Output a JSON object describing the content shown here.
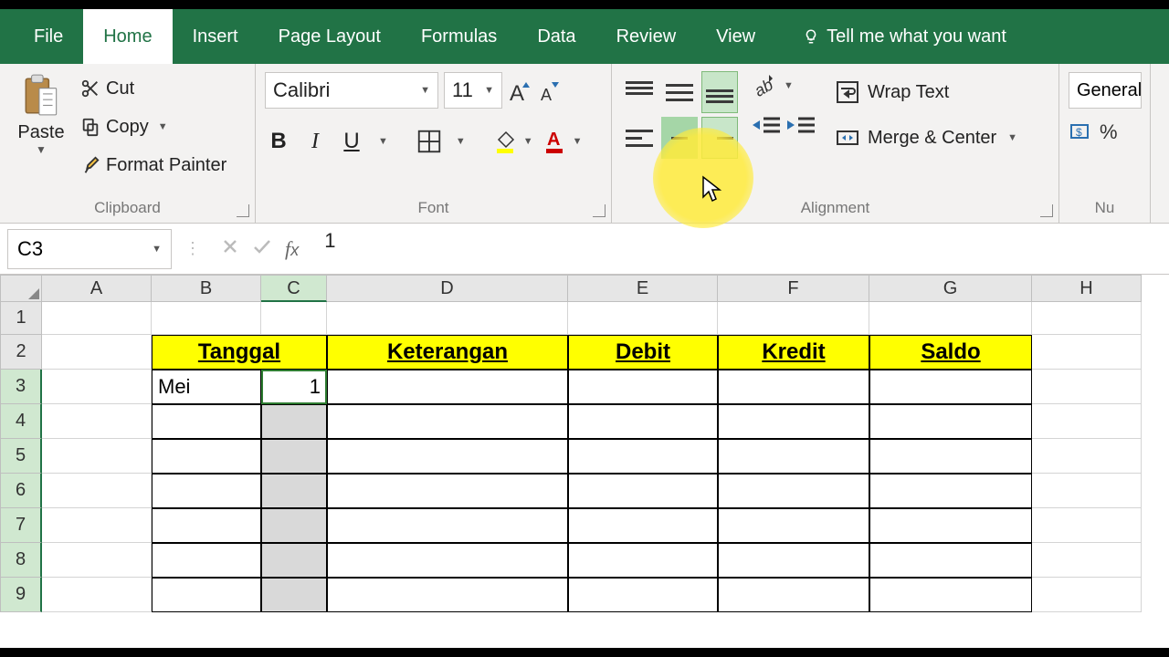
{
  "ribbonTabs": {
    "file": "File",
    "home": "Home",
    "insert": "Insert",
    "pageLayout": "Page Layout",
    "formulas": "Formulas",
    "data": "Data",
    "review": "Review",
    "view": "View",
    "tellMe": "Tell me what you want"
  },
  "clipboard": {
    "paste": "Paste",
    "cut": "Cut",
    "copy": "Copy",
    "formatPainter": "Format Painter",
    "label": "Clipboard"
  },
  "font": {
    "name": "Calibri",
    "size": "11",
    "label": "Font"
  },
  "alignment": {
    "wrap": "Wrap Text",
    "merge": "Merge & Center",
    "label": "Alignment"
  },
  "number": {
    "format": "General",
    "label": "Nu"
  },
  "nameBox": "C3",
  "formulaBar": "1",
  "columns": [
    "A",
    "B",
    "C",
    "D",
    "E",
    "F",
    "G",
    "H"
  ],
  "rowNums": [
    "1",
    "2",
    "3",
    "4",
    "5",
    "6",
    "7",
    "8",
    "9"
  ],
  "headers": {
    "tanggal": "Tanggal",
    "keterangan": "Keterangan",
    "debit": "Debit",
    "kredit": "Kredit",
    "saldo": "Saldo"
  },
  "cells": {
    "B3": "Mei",
    "C3": "1"
  },
  "colors": {
    "brand": "#217346",
    "highlight": "#ffff00",
    "selection": "#2e7d32"
  }
}
